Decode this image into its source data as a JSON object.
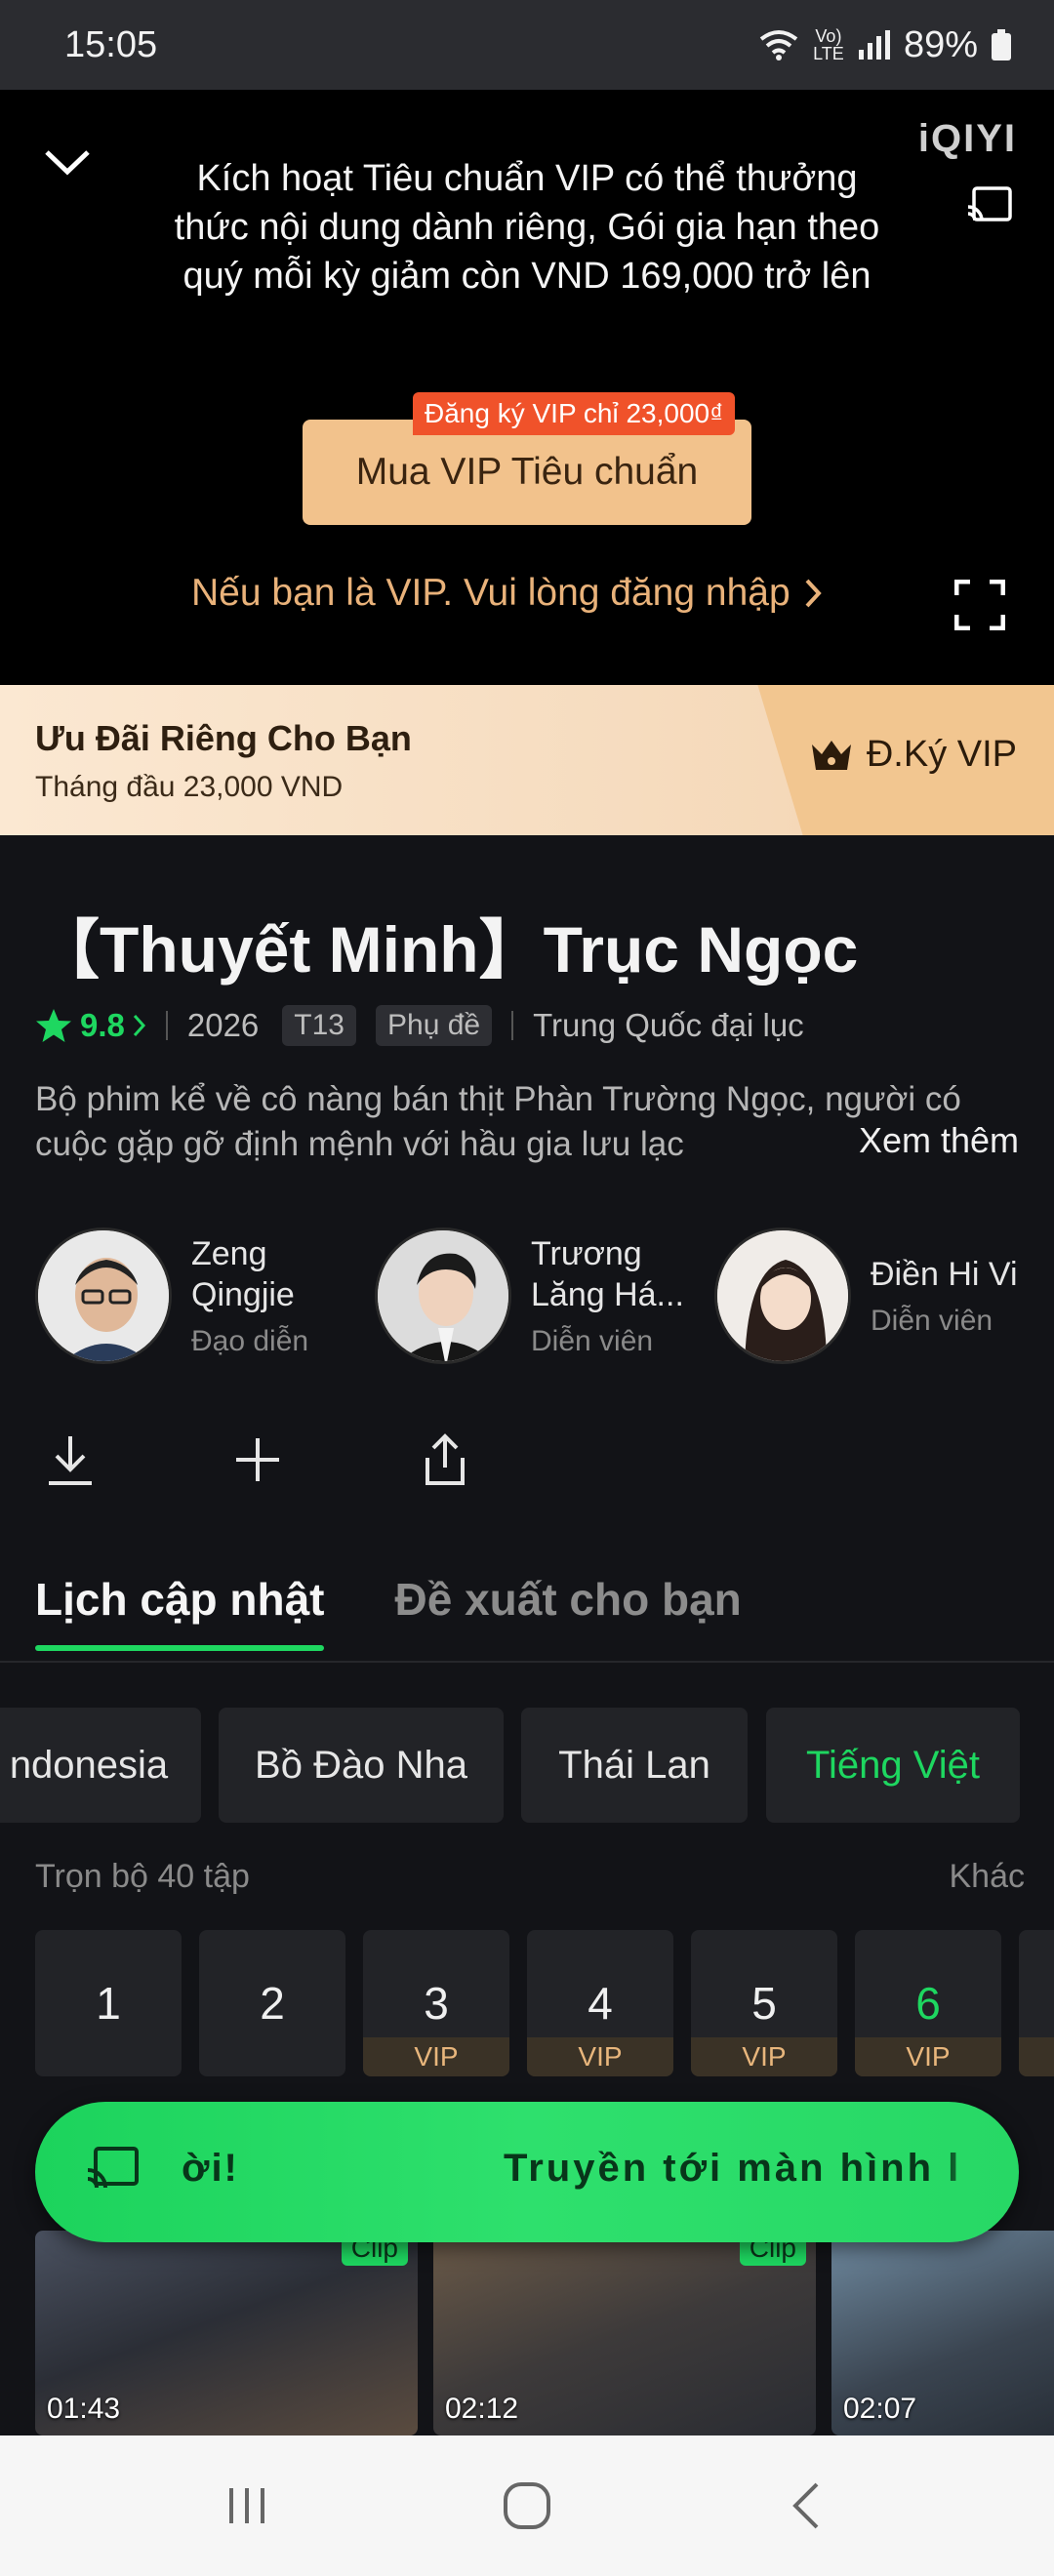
{
  "status_bar": {
    "time": "15:05",
    "network": "Vo) LTE",
    "battery": "89%"
  },
  "player": {
    "brand": "iQIYI",
    "promo_text": "Kích hoạt Tiêu chuẩn  VIP có thể thưởng thức nội dung dành riêng, Gói gia hạn theo quý mỗi kỳ giảm còn VND 169,000 trở lên",
    "buy_badge": "Đăng ký VIP chỉ 23,000₫",
    "buy_button": "Mua VIP Tiêu chuẩn",
    "login_link": "Nếu bạn là VIP. Vui lòng đăng nhập"
  },
  "offer": {
    "title": "Ưu Đãi Riêng Cho Bạn",
    "subtitle": "Tháng đầu 23,000 VND",
    "cta": "Đ.Ký VIP"
  },
  "show": {
    "title": "【Thuyết Minh】Trục Ngọc",
    "rating": "9.8",
    "year": "2026",
    "age_tag": "T13",
    "subtitle_tag": "Phụ đề",
    "region": "Trung Quốc đại lục",
    "description": "Bộ phim kể về cô nàng bán thịt Phàn Trường Ngọc, người có cuộc gặp gỡ định mệnh với hầu gia lưu lạc",
    "more": "Xem thêm"
  },
  "cast": [
    {
      "name": "Zeng Qingjie",
      "role": "Đạo diễn"
    },
    {
      "name": "Trương Lăng Há...",
      "role": "Diễn viên"
    },
    {
      "name": "Điền Hi Vi",
      "role": "Diễn viên"
    }
  ],
  "tabs": {
    "active": "Lịch cập nhật",
    "other": "Đề xuất cho bạn"
  },
  "languages": [
    {
      "label": "ndonesia",
      "selected": false
    },
    {
      "label": "Bồ Đào Nha",
      "selected": false
    },
    {
      "label": "Thái Lan",
      "selected": false
    },
    {
      "label": "Tiếng Việt",
      "selected": true
    }
  ],
  "episodes": {
    "header": "Trọn bộ 40 tập",
    "other": "Khác",
    "vip_label": "VIP",
    "items": [
      "1",
      "2",
      "3",
      "4",
      "5",
      "6"
    ]
  },
  "toast": {
    "left_text": "ời!",
    "right_text": "Truyền tới màn hình l"
  },
  "clips": [
    {
      "tag": "Clip",
      "duration": "01:43"
    },
    {
      "tag": "Clip",
      "duration": "02:12"
    },
    {
      "tag": "",
      "duration": "02:07"
    }
  ]
}
